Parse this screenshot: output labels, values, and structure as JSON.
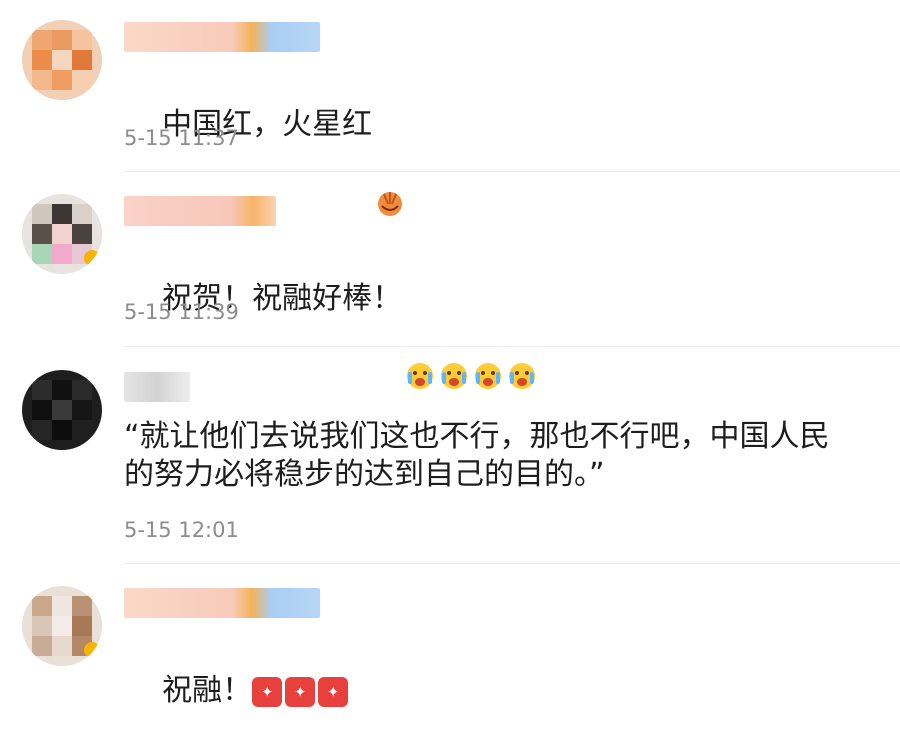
{
  "comments": [
    {
      "text": "中国红，火星红",
      "time": "5-15 11:37",
      "emojis": [
        "clapping-hands-icon"
      ]
    },
    {
      "text": "祝贺！祝融好棒！",
      "time": "5-15 11:39",
      "emojis": [
        "crying-face-icon",
        "crying-face-icon",
        "crying-face-icon",
        "crying-face-icon"
      ]
    },
    {
      "text": "“就让他们去说我们这也不行，那也不行吧，中国人民\n的努力必将稳步的达到自己的目的。”",
      "time": "5-15 12:01",
      "emojis": []
    },
    {
      "text": "祝融！",
      "time": "",
      "emojis": [
        "cheer-badge-icon",
        "cheer-badge-icon",
        "cheer-badge-icon"
      ]
    }
  ],
  "colors": {
    "time_text": "#8c8c8c",
    "divider": "#ececec",
    "badge_red": "#e8403d"
  }
}
